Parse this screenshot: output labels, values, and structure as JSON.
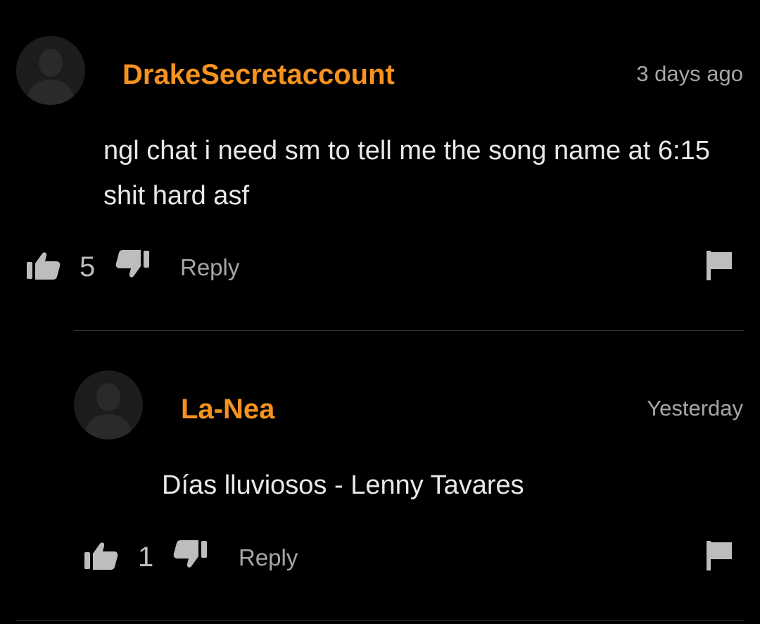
{
  "comments": [
    {
      "username": "DrakeSecretaccount",
      "timestamp": "3 days ago",
      "text": "ngl chat i need sm to tell me the song name at 6:15 shit hard asf",
      "likes": "5",
      "reply_label": "Reply"
    },
    {
      "username": "La-Nea",
      "timestamp": "Yesterday",
      "text": "Días lluviosos - Lenny Tavares",
      "likes": "1",
      "reply_label": "Reply"
    }
  ],
  "colors": {
    "background": "#000000",
    "username": "#f6921e",
    "text": "#e8e8e8",
    "muted": "#a6a6a6"
  },
  "icons": {
    "avatar": "default-avatar-icon",
    "like": "thumbs-up-icon",
    "dislike": "thumbs-down-icon",
    "report": "flag-icon"
  }
}
